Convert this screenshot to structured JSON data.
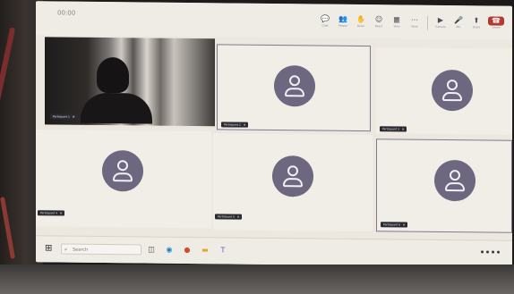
{
  "meeting": {
    "elapsed": "00:00",
    "toolbar": [
      {
        "name": "chat-button",
        "glyph": "💬",
        "label": "Chat"
      },
      {
        "name": "people-button",
        "glyph": "👥",
        "label": "People"
      },
      {
        "name": "raise-hand-button",
        "glyph": "✋",
        "label": "Raise"
      },
      {
        "name": "react-button",
        "glyph": "☺",
        "label": "React"
      },
      {
        "name": "view-button",
        "glyph": "▦",
        "label": "View"
      },
      {
        "name": "more-button",
        "glyph": "⋯",
        "label": "More"
      },
      {
        "name": "camera-button",
        "glyph": "▶",
        "label": "Camera"
      },
      {
        "name": "mic-button",
        "glyph": "🎤",
        "label": "Mic"
      },
      {
        "name": "share-button",
        "glyph": "⬆",
        "label": "Share"
      },
      {
        "name": "leave-button",
        "glyph": "☎",
        "label": "Leave"
      }
    ]
  },
  "participants": [
    {
      "name": "Participant 1",
      "video_on": true,
      "muted": true
    },
    {
      "name": "Participant 2",
      "video_on": false,
      "muted": true
    },
    {
      "name": "Participant 3",
      "video_on": false,
      "muted": true
    },
    {
      "name": "Participant 4",
      "video_on": false,
      "muted": true
    },
    {
      "name": "Participant 5",
      "video_on": false,
      "muted": true
    },
    {
      "name": "Participant 6",
      "video_on": false,
      "muted": true
    }
  ],
  "icons": {
    "avatar": "person-placeholder-icon",
    "mic_off": "mic-off-icon"
  },
  "colors": {
    "avatar_bg": "#6e6780",
    "nameplate_bg": "#2c2a31",
    "tile_bg": "#f1eee8",
    "leave_red": "#b3392f"
  },
  "taskbar": {
    "search_placeholder": "Search",
    "apps": [
      {
        "name": "task-view-icon",
        "glyph": "◫",
        "color": "#3a3a44"
      },
      {
        "name": "edge-icon",
        "glyph": "◉",
        "color": "#1f7fc4"
      },
      {
        "name": "chrome-icon",
        "glyph": "●",
        "color": "#d04a2e"
      },
      {
        "name": "file-explorer-icon",
        "glyph": "▬",
        "color": "#e0a72a"
      },
      {
        "name": "teams-icon",
        "glyph": "T",
        "color": "#5b5fc7"
      }
    ]
  }
}
